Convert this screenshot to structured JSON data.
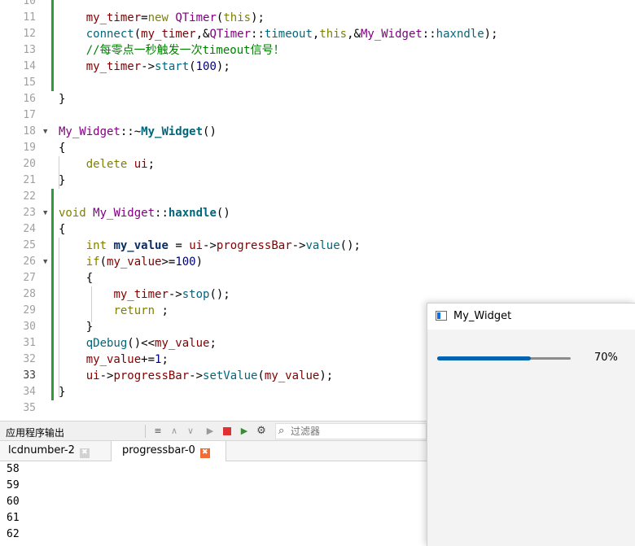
{
  "editor": {
    "lines": [
      {
        "no": "10",
        "tokens": []
      },
      {
        "no": "11",
        "tokens": [
          [
            "    ",
            "default"
          ],
          [
            "my_timer",
            "member"
          ],
          [
            "=",
            "op"
          ],
          [
            "new",
            "keyword"
          ],
          [
            " ",
            "default"
          ],
          [
            "QTimer",
            "type"
          ],
          [
            "(",
            "op"
          ],
          [
            "this",
            "keyword"
          ],
          [
            ");",
            "op"
          ]
        ]
      },
      {
        "no": "12",
        "tokens": [
          [
            "    ",
            "default"
          ],
          [
            "connect",
            "func"
          ],
          [
            "(",
            "op"
          ],
          [
            "my_timer",
            "member"
          ],
          [
            ",&",
            "op"
          ],
          [
            "QTimer",
            "type"
          ],
          [
            "::",
            "op"
          ],
          [
            "timeout",
            "func"
          ],
          [
            ",",
            "op"
          ],
          [
            "this",
            "keyword"
          ],
          [
            ",&",
            "op"
          ],
          [
            "My_Widget",
            "type"
          ],
          [
            "::",
            "op"
          ],
          [
            "haxndle",
            "func"
          ],
          [
            ");",
            "op"
          ]
        ]
      },
      {
        "no": "13",
        "tokens": [
          [
            "    ",
            "default"
          ],
          [
            "//每零点一秒触发一次timeout信号！",
            "comment"
          ]
        ]
      },
      {
        "no": "14",
        "tokens": [
          [
            "    ",
            "default"
          ],
          [
            "my_timer",
            "member"
          ],
          [
            "->",
            "op"
          ],
          [
            "start",
            "func"
          ],
          [
            "(",
            "op"
          ],
          [
            "100",
            "number"
          ],
          [
            ");",
            "op"
          ]
        ]
      },
      {
        "no": "15",
        "tokens": []
      },
      {
        "no": "16",
        "tokens": [
          [
            "}",
            "op"
          ]
        ]
      },
      {
        "no": "17",
        "tokens": []
      },
      {
        "no": "18",
        "tokens": [
          [
            "My_Widget",
            "type"
          ],
          [
            "::~",
            "op"
          ],
          [
            "My_Widget",
            "funcdef"
          ],
          [
            "()",
            "op"
          ]
        ]
      },
      {
        "no": "19",
        "tokens": [
          [
            "{",
            "op"
          ]
        ]
      },
      {
        "no": "20",
        "tokens": [
          [
            "    ",
            "default"
          ],
          [
            "delete",
            "keyword"
          ],
          [
            " ",
            "default"
          ],
          [
            "ui",
            "member"
          ],
          [
            ";",
            "op"
          ]
        ]
      },
      {
        "no": "21",
        "tokens": [
          [
            "}",
            "op"
          ]
        ]
      },
      {
        "no": "22",
        "tokens": []
      },
      {
        "no": "23",
        "tokens": [
          [
            "void",
            "keyword"
          ],
          [
            " ",
            "default"
          ],
          [
            "My_Widget",
            "type"
          ],
          [
            "::",
            "op"
          ],
          [
            "haxndle",
            "funcdef"
          ],
          [
            "()",
            "op"
          ]
        ]
      },
      {
        "no": "24",
        "tokens": [
          [
            "{",
            "op"
          ]
        ]
      },
      {
        "no": "25",
        "tokens": [
          [
            "    ",
            "default"
          ],
          [
            "int",
            "keyword"
          ],
          [
            " ",
            "default"
          ],
          [
            "my_value",
            "local"
          ],
          [
            " = ",
            "op"
          ],
          [
            "ui",
            "member"
          ],
          [
            "->",
            "op"
          ],
          [
            "progressBar",
            "member"
          ],
          [
            "->",
            "op"
          ],
          [
            "value",
            "func"
          ],
          [
            "();",
            "op"
          ]
        ]
      },
      {
        "no": "26",
        "tokens": [
          [
            "    ",
            "default"
          ],
          [
            "if",
            "keyword"
          ],
          [
            "(",
            "op"
          ],
          [
            "my_value",
            "member"
          ],
          [
            ">=",
            "op"
          ],
          [
            "100",
            "number"
          ],
          [
            ")",
            "op"
          ]
        ]
      },
      {
        "no": "27",
        "tokens": [
          [
            "    {",
            "op"
          ]
        ]
      },
      {
        "no": "28",
        "tokens": [
          [
            "        ",
            "default"
          ],
          [
            "my_timer",
            "member"
          ],
          [
            "->",
            "op"
          ],
          [
            "stop",
            "func"
          ],
          [
            "();",
            "op"
          ]
        ]
      },
      {
        "no": "29",
        "tokens": [
          [
            "        ",
            "default"
          ],
          [
            "return",
            "keyword"
          ],
          [
            " ;",
            "op"
          ]
        ]
      },
      {
        "no": "30",
        "tokens": [
          [
            "    }",
            "op"
          ]
        ]
      },
      {
        "no": "31",
        "tokens": [
          [
            "    ",
            "default"
          ],
          [
            "qDebug",
            "func"
          ],
          [
            "()<<",
            "op"
          ],
          [
            "my_value",
            "member"
          ],
          [
            ";",
            "op"
          ]
        ]
      },
      {
        "no": "32",
        "tokens": [
          [
            "    ",
            "default"
          ],
          [
            "my_value",
            "member"
          ],
          [
            "+=",
            "op"
          ],
          [
            "1",
            "number"
          ],
          [
            ";",
            "op"
          ]
        ]
      },
      {
        "no": "33",
        "tokens": [
          [
            "    ",
            "default"
          ],
          [
            "ui",
            "member"
          ],
          [
            "->",
            "op"
          ],
          [
            "progressBar",
            "member"
          ],
          [
            "->",
            "op"
          ],
          [
            "setValue",
            "func"
          ],
          [
            "(",
            "op"
          ],
          [
            "my_value",
            "member"
          ],
          [
            ");",
            "op"
          ]
        ]
      },
      {
        "no": "34",
        "tokens": [
          [
            "}",
            "op"
          ]
        ]
      },
      {
        "no": "35",
        "tokens": []
      }
    ]
  },
  "output_panel": {
    "title": "应用程序输出",
    "filter_placeholder": "过滤器",
    "tabs": [
      {
        "label": "lcdnumber-2",
        "active": false
      },
      {
        "label": "progressbar-0",
        "active": true
      }
    ],
    "lines": [
      "58",
      "59",
      "60",
      "61",
      "62"
    ]
  },
  "widget": {
    "title": "My_Widget",
    "progress_value": 70,
    "progress_text": "70%"
  },
  "colors": {
    "accent": "#0063b1",
    "modified_marker": "#2e9b3a",
    "active_tab_close": "#f26b35"
  },
  "icons": [
    "fold-arrow-icon",
    "filter-search-icon",
    "run-icon",
    "stop-icon",
    "settings-icon",
    "window-icon",
    "tab-close-icon"
  ]
}
